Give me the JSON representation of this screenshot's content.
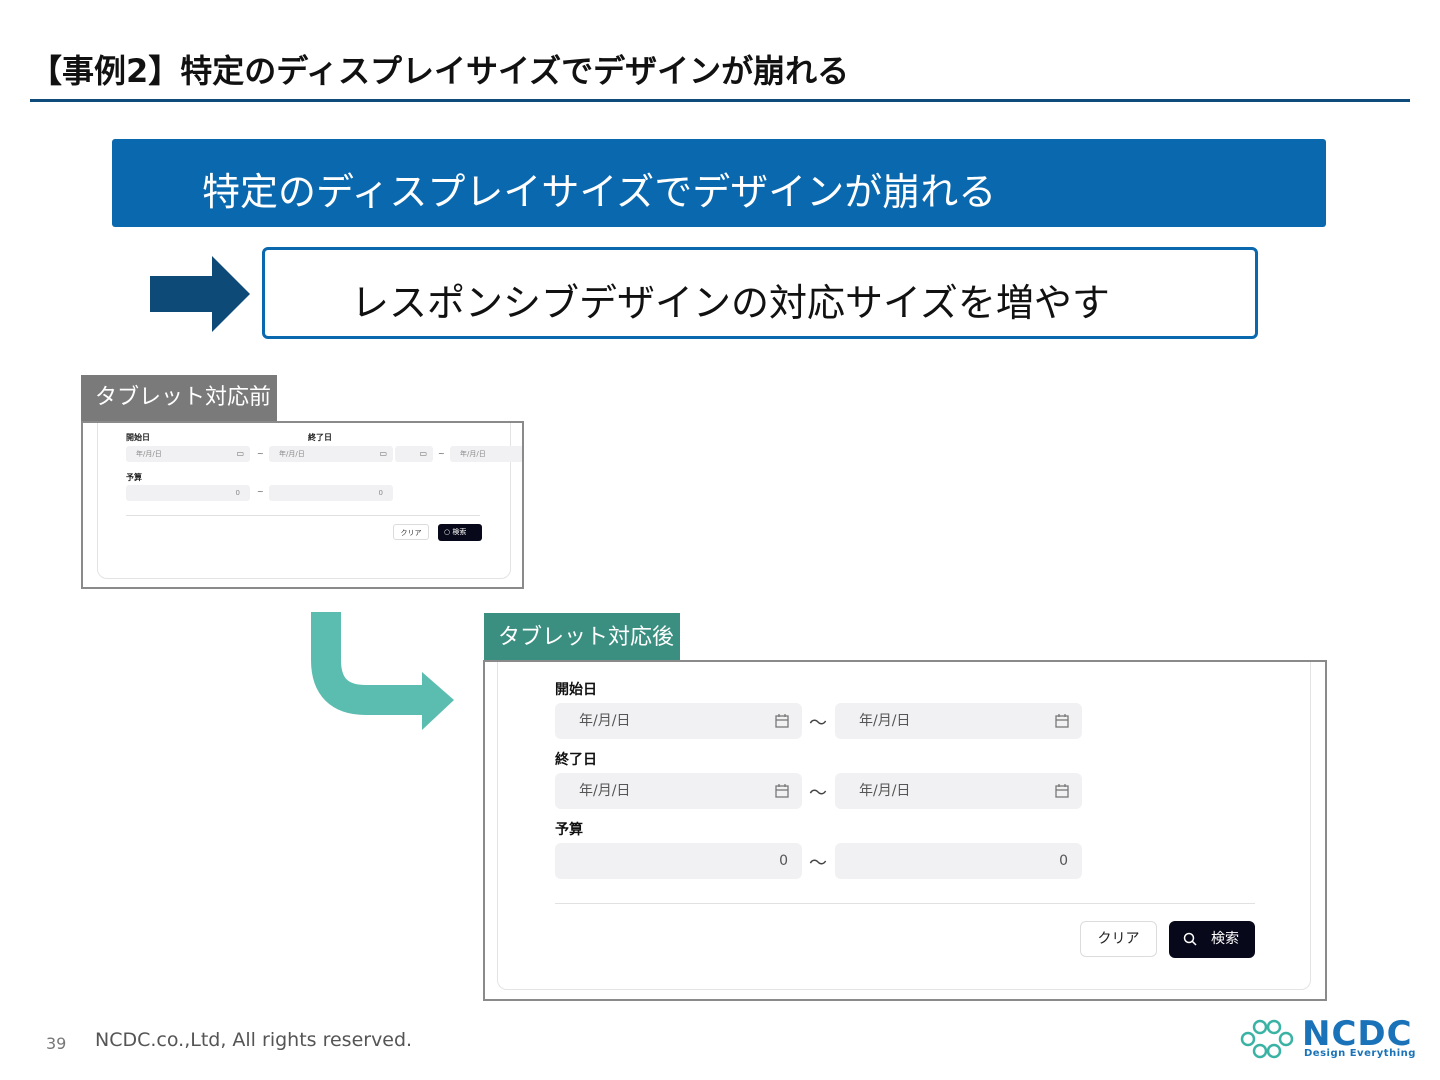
{
  "header": {
    "title": "【事例2】特定のディスプレイサイズでデザインが崩れる"
  },
  "problem": {
    "text": "特定のディスプレイサイズでデザインが崩れる"
  },
  "solution": {
    "text": "レスポンシブデザインの対応サイズを増やす"
  },
  "before": {
    "tab_label": "タブレット対応前",
    "start_label": "開始日",
    "end_label": "終了日",
    "budget_label": "予算",
    "date_placeholder": "年/月/日",
    "number_value": "0",
    "tilde": "~",
    "clear_label": "クリア",
    "search_label": "検索"
  },
  "after": {
    "tab_label": "タブレット対応後",
    "start_label": "開始日",
    "end_label": "終了日",
    "budget_label": "予算",
    "date_placeholder": "年/月/日",
    "number_value": "0",
    "tilde": "〜",
    "clear_label": "クリア",
    "search_label": "検索"
  },
  "footer": {
    "page_number": "39",
    "copyright": "NCDC.co.,Ltd, All rights reserved.",
    "logo_name": "NCDC",
    "logo_tagline": "Design Everything"
  },
  "colors": {
    "primary_blue": "#0a68ae",
    "title_rule": "#0e4a7a",
    "teal": "#5bbcb0",
    "before_tab": "#7a7a7a",
    "after_tab": "#3b8f80",
    "search_button": "#07091a"
  },
  "icons": [
    "arrow-right-icon",
    "curved-arrow-icon",
    "calendar-icon",
    "search-icon",
    "ncdc-logo-icon"
  ]
}
